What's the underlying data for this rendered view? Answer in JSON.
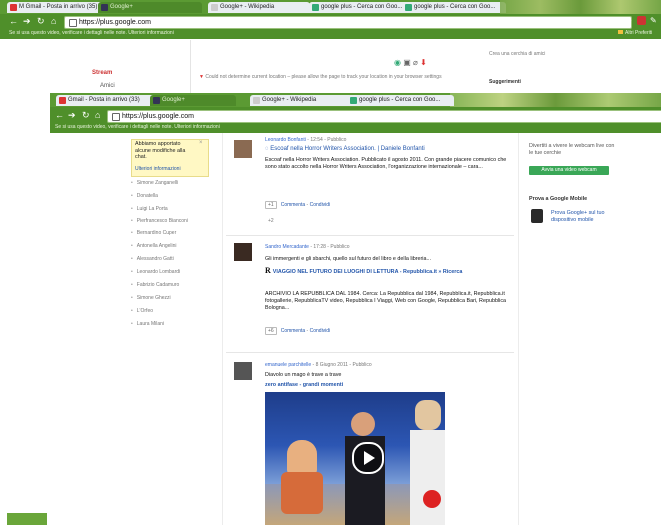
{
  "browser_back": {
    "tabs": [
      "M Gmail - Posta in arrivo (35)",
      "Google+",
      "Google+ - Wikipedia",
      "google plus - Cerca con Goo...",
      "google plus - Cerca con Goo..."
    ],
    "url": "https://plus.google.com",
    "notification_bar": "Se si usa questo video, verificare i dettagli nelle note. Ulteriori informazioni",
    "bookmarks_right": "Altri Preferiti",
    "side_title": "Stream",
    "side_sub": "Amici",
    "location_warning": "Could not determine current location – please allow the page to track your location in your browser settings",
    "right_top": "Crea una cerchia di amici",
    "right_mid": "Suggerimenti"
  },
  "browser_front": {
    "tabs": [
      "Gmail - Posta in arrivo (33)",
      "Google+",
      "Google+ - Wikipedia",
      "google plus - Cerca con Goo..."
    ],
    "url": "https://plus.google.com",
    "notification_bar": "Se si usa questo video, verificare i dettagli nelle note. Ulteriori informazioni"
  },
  "sidebar": {
    "notice_title": "Abbiamo apportato alcune modifiche alla chat.",
    "notice_link": "Ulteriori informazioni",
    "items": [
      "Simone Zanganelli",
      "Donatella",
      "Luigi La Porta",
      "Pierfrancesco Bianconi",
      "Bernardino Cuper",
      "Antonella Angelini",
      "Alessandro Gatti",
      "Leonardo Lombardi",
      "Fabrizio Cadamuro",
      "Simone Ghezzi",
      "L'Orfeo",
      "Laura Milani"
    ]
  },
  "posts": [
    {
      "author": "Leonardo Bonfanti",
      "meta": "- 12:54 - Pubblico",
      "link_title": "Escoaf nella Horror Writers Association. | Daniele Bonfanti",
      "body": "Escoaf nella Horror Writers Association. Pubblicato il agosto 2011. Con grande piacere comunico che sono stato accolto nella Horror Writers Association, l'organizzazione internazionale – cara...",
      "plus": "+1",
      "comment": "Commenta",
      "share": "Condividi",
      "reply": "+2"
    },
    {
      "author": "Sandro Mercadante",
      "meta": "- 17:28 - Pubblico",
      "intro": "Gli immergenti e gli sbarchi, quello sul futuro del libro e della libreria...",
      "link_title": "VIAGGIO NEL FUTURO DEI LUOGHI DI LETTURA - Repubblica.it » Ricerca",
      "body": "ARCHIVIO LA REPUBBLICA DAL 1984. Cerca: La Repubblica dal 1984, Repubblica.it, Repubblica.it fotogallerie, RepubblicaTV video, Repubblica I Viaggi, Web con Google, Repubblica Bari, Repubblica Bologna...",
      "plus": "+6",
      "comment": "Commenta",
      "share": "Condividi"
    },
    {
      "author": "emanuele parchitelle",
      "meta": "- 8 Giugno 2011 - Pubblico",
      "intro": "Diavolo un mago è trave a trave",
      "link_title": "zero antifase - grandi momenti"
    }
  ],
  "right_panel": {
    "invite_text": "Divertiti a vivere le webcam live con le tue cerchie",
    "invite_button": "Avvia una video webcam",
    "mobile_title": "Prova a Google Mobile",
    "mobile_text": "Prova Google+ sul tuo dispositivo mobile"
  },
  "colors": {
    "chrome_green": "#4f8f2a",
    "link_blue": "#2255aa",
    "button_green": "#3aa757"
  }
}
